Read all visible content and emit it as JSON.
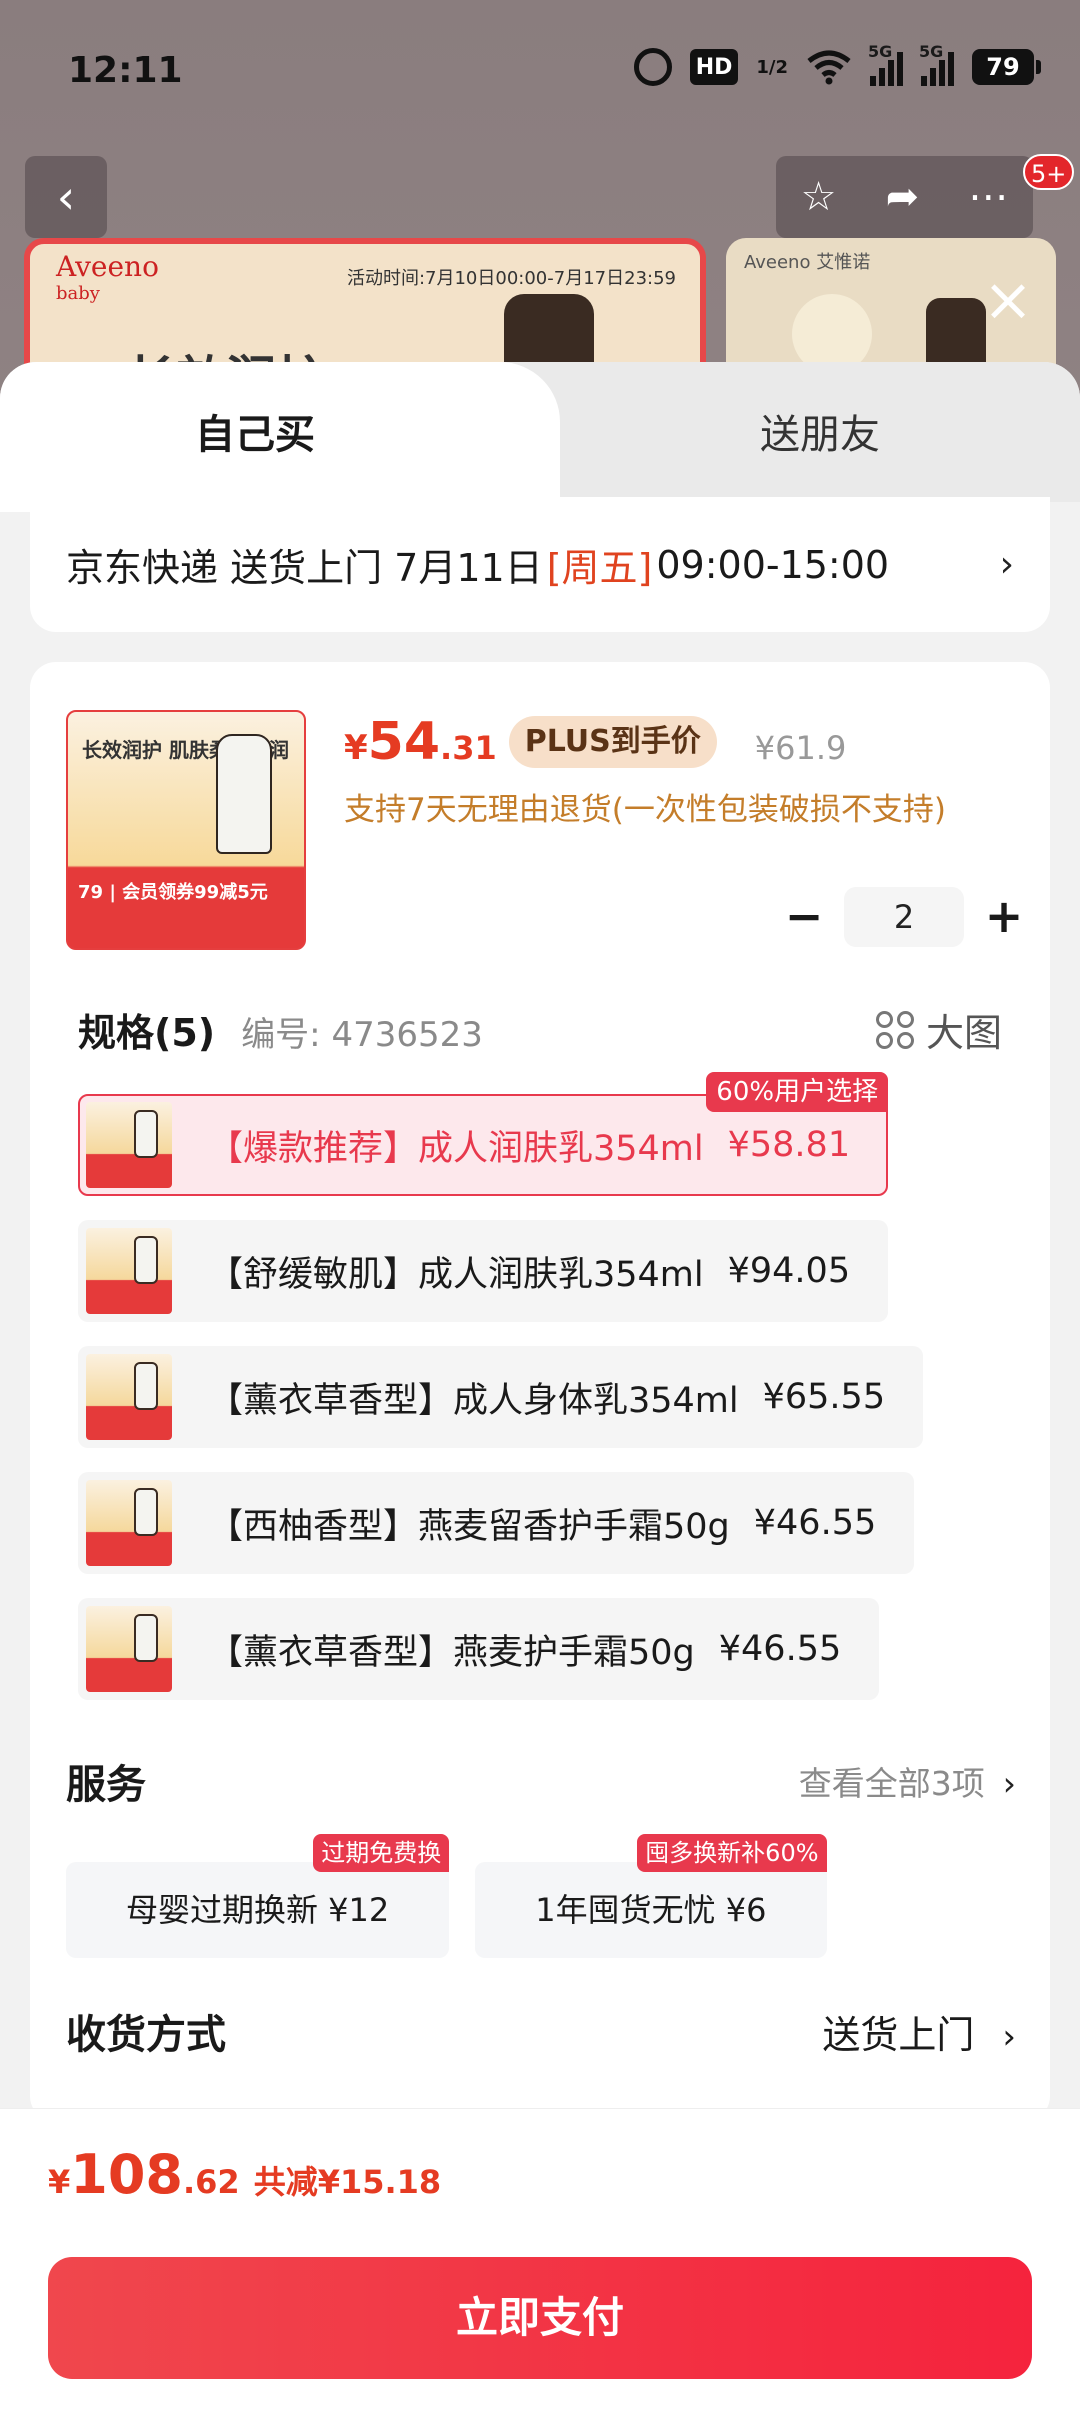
{
  "status_bar": {
    "time": "12:11",
    "hd_label": "HD",
    "hd_sub": "1/2",
    "signal1_tag": "5G",
    "signal2_tag": "5G",
    "battery": "79"
  },
  "background": {
    "message_badge": "5+",
    "banner_logo": "Aveeno",
    "banner_logo_sub": "baby",
    "banner_activity": "活动时间:7月10日00:00-7月17日23:59",
    "banner_headline": "长效润护",
    "side_logo": "Aveeno 艾惟诺",
    "icons": [
      "back-icon",
      "star-icon",
      "share-icon",
      "more-icon",
      "close-icon"
    ]
  },
  "tabs": {
    "self": "自己买",
    "gift": "送朋友"
  },
  "delivery": {
    "text": "京东快递 送货上门 7月11日",
    "weekday": "[周五]",
    "time": "09:00-15:00",
    "chevron": "›"
  },
  "product": {
    "image_text": "长效润护 肌肤柔嫩水润",
    "image_price": "79 | 会员领券99减5元",
    "price_yen": "¥",
    "price_int": "54",
    "price_dec": ".31",
    "plus_label": "PLUS到手价",
    "orig_price": "¥61.9",
    "return_note": "支持7天无理由退货(一次性包装破损不支持)",
    "qty_minus": "−",
    "qty": "2",
    "qty_plus": "+"
  },
  "spec": {
    "title": "规格(5)",
    "code": "编号: 4736523",
    "big_image": "大图",
    "items": [
      {
        "name": "【爆款推荐】成人润肤乳354ml",
        "price": "¥58.81",
        "badge": "60%用户选择",
        "selected": true
      },
      {
        "name": "【舒缓敏肌】成人润肤乳354ml",
        "price": "¥94.05"
      },
      {
        "name": "【薰衣草香型】成人身体乳354ml",
        "price": "¥65.55"
      },
      {
        "name": "【西柚香型】燕麦留香护手霜50g",
        "price": "¥46.55"
      },
      {
        "name": "【薰衣草香型】燕麦护手霜50g",
        "price": "¥46.55"
      }
    ]
  },
  "services": {
    "title": "服务",
    "more": "查看全部3项",
    "chevron": "›",
    "items": [
      {
        "label": "母婴过期换新 ¥12",
        "badge": "过期免费换"
      },
      {
        "label": "1年囤货无忧 ¥6",
        "badge": "囤多换新补60%"
      }
    ]
  },
  "shipping": {
    "title": "收货方式",
    "value": "送货上门",
    "chevron": "›"
  },
  "bottom": {
    "yen": "¥",
    "total_int": "108",
    "total_dec": ".62",
    "saved": "共减¥15.18",
    "pay": "立即支付"
  },
  "colors": {
    "accent_red": "#e53b22",
    "spec_selected": "#e8394d",
    "return_note": "#c47d2a",
    "plus_badge_bg": "#f7dfc9"
  }
}
